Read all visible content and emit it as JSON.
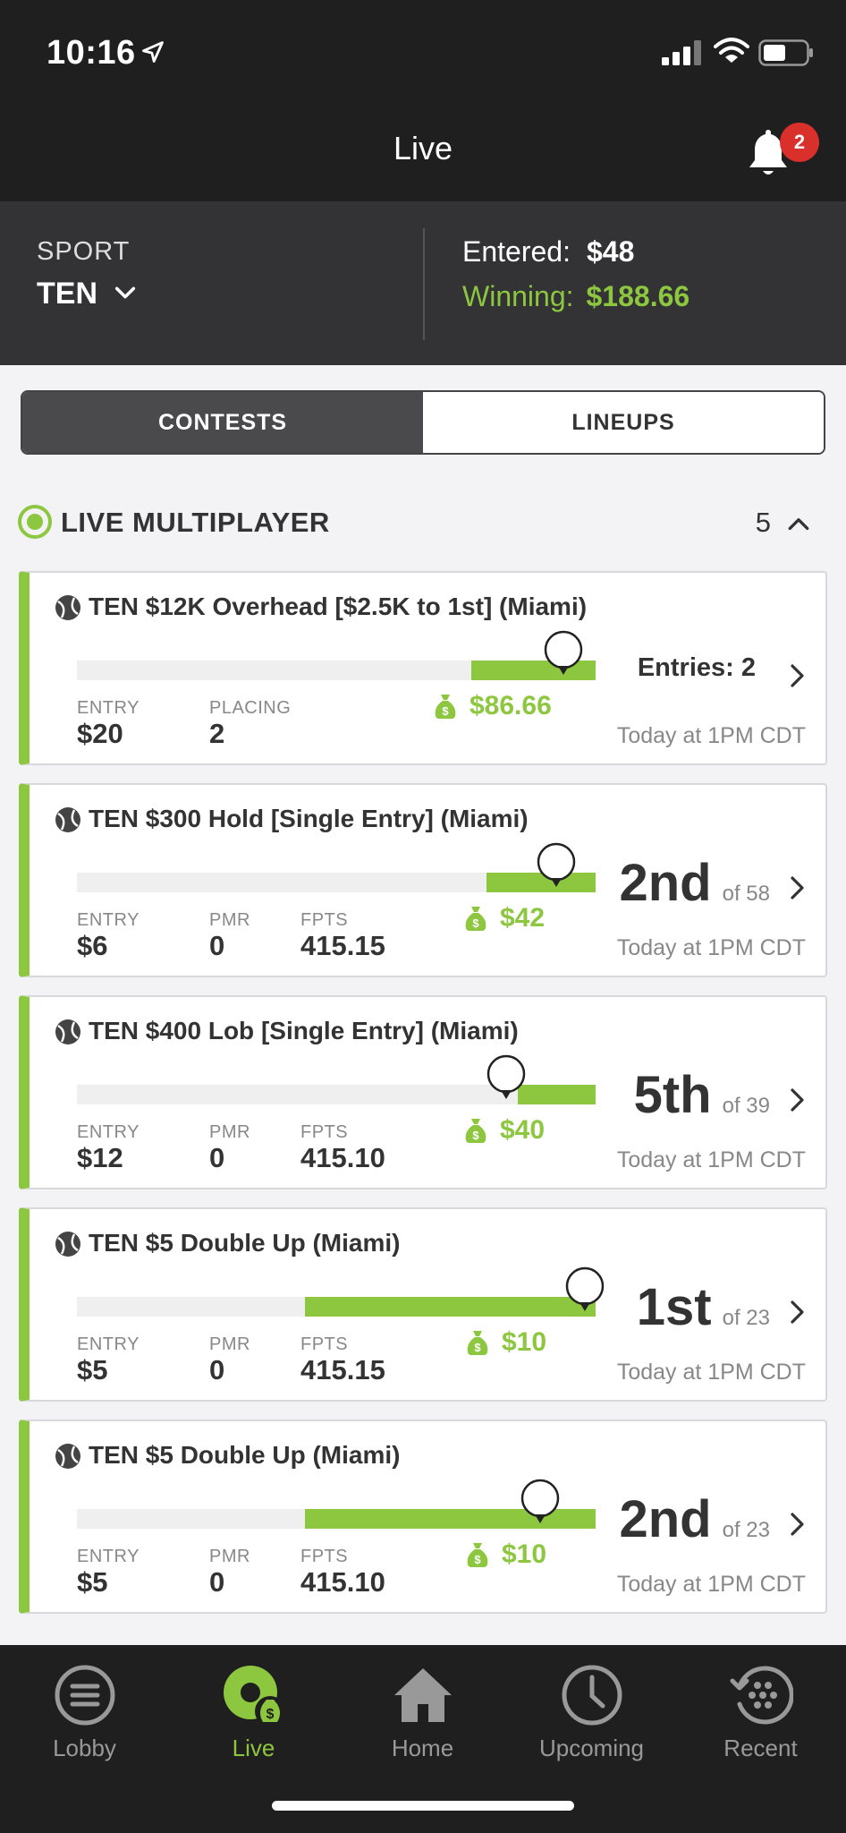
{
  "status_bar": {
    "time": "10:16"
  },
  "header": {
    "title": "Live",
    "notification_count": "2"
  },
  "summary": {
    "sport_label": "SPORT",
    "sport_value": "TEN",
    "entered_label": "Entered:",
    "entered_value": "$48",
    "winning_label": "Winning:",
    "winning_value": "$188.66"
  },
  "segment": {
    "contests": "CONTESTS",
    "lineups": "LINEUPS",
    "active": "CONTESTS"
  },
  "section": {
    "label": "LIVE MULTIPLAYER",
    "count": "5"
  },
  "contests": [
    {
      "name": "TEN $12K Overhead [$2.5K to 1st] (Miami)",
      "progress": 0.24,
      "stats": [
        {
          "label": "ENTRY",
          "value": "$20"
        },
        {
          "label": "PLACING",
          "value": "2"
        }
      ],
      "prize": "$86.66",
      "entries": "Entries: 2",
      "time": "Today at 1PM CDT"
    },
    {
      "name": "TEN $300 Hold [Single Entry] (Miami)",
      "progress": 0.21,
      "stats": [
        {
          "label": "ENTRY",
          "value": "$6"
        },
        {
          "label": "PMR",
          "value": "0"
        },
        {
          "label": "FPTS",
          "value": "415.15"
        }
      ],
      "prize": "$42",
      "rank": "2nd",
      "of": "of 58",
      "time": "Today at 1PM CDT"
    },
    {
      "name": "TEN $400 Lob [Single Entry] (Miami)",
      "progress": 0.15,
      "stats": [
        {
          "label": "ENTRY",
          "value": "$12"
        },
        {
          "label": "PMR",
          "value": "0"
        },
        {
          "label": "FPTS",
          "value": "415.10"
        }
      ],
      "prize": "$40",
      "rank": "5th",
      "of": "of 39",
      "time": "Today at 1PM CDT"
    },
    {
      "name": "TEN $5 Double Up (Miami)",
      "progress": 0.56,
      "stats": [
        {
          "label": "ENTRY",
          "value": "$5"
        },
        {
          "label": "PMR",
          "value": "0"
        },
        {
          "label": "FPTS",
          "value": "415.15"
        }
      ],
      "prize": "$10",
      "rank": "1st",
      "of": "of 23",
      "time": "Today at 1PM CDT"
    },
    {
      "name": "TEN $5 Double Up (Miami)",
      "progress": 0.56,
      "stats": [
        {
          "label": "ENTRY",
          "value": "$5"
        },
        {
          "label": "PMR",
          "value": "0"
        },
        {
          "label": "FPTS",
          "value": "415.10"
        }
      ],
      "prize": "$10",
      "rank": "2nd",
      "of": "of 23",
      "time": "Today at 1PM CDT"
    }
  ],
  "tabbar": {
    "items": [
      {
        "label": "Lobby",
        "icon": "menu-circle-icon"
      },
      {
        "label": "Live",
        "icon": "live-money-icon",
        "active": true
      },
      {
        "label": "Home",
        "icon": "home-icon"
      },
      {
        "label": "Upcoming",
        "icon": "clock-icon"
      },
      {
        "label": "Recent",
        "icon": "history-icon"
      }
    ]
  },
  "colors": {
    "accent": "#8dc63f",
    "dark": "#1f1f1f",
    "panel": "#333335",
    "badge": "#d9302c"
  }
}
